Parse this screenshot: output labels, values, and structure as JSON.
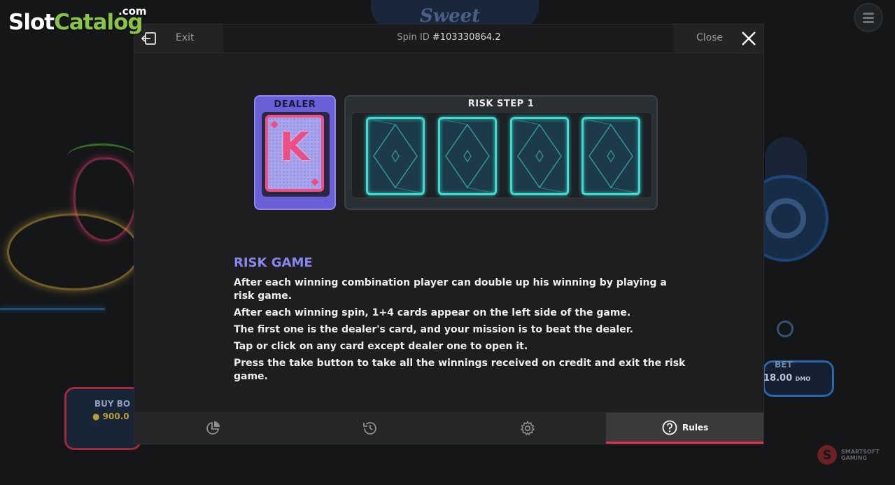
{
  "watermark": {
    "part1": "Slot",
    "part2": "Catalog",
    "part3": ".com"
  },
  "background": {
    "game_title": "Sweet",
    "buy_bonus_label": "BUY BO",
    "buy_bonus_value": "900.0",
    "bet_label": "BET",
    "bet_value": "18.00",
    "bet_currency": "DMO",
    "brand_line1": "SMARTSOFT",
    "brand_line2": "GAMING",
    "brand_logo": "S"
  },
  "topbar": {
    "exit_label": "Exit",
    "spin_id_label": "Spin ID",
    "spin_id_value": "#103330864.2",
    "close_label": "Close"
  },
  "dealer": {
    "title": "DEALER",
    "card_rank": "K",
    "card_color": "#ec4f85"
  },
  "risk": {
    "title": "RISK STEP 1",
    "card_count": 4,
    "card_color": "#43d8cf"
  },
  "rules": {
    "heading": "RISK GAME",
    "paragraphs": [
      "After each winning combination player can double up his winning by playing a risk game.",
      "After each winning spin, 1+4 cards appear on the left side of the game.",
      "The first one is the dealer's card, and your mission is to beat the dealer.",
      "Tap or click on any card except dealer one to open it.",
      "Press the take button to take all the winnings received on credit and exit the risk game."
    ]
  },
  "tabs": [
    {
      "icon": "pie-chart-icon",
      "label": "",
      "active": false
    },
    {
      "icon": "history-icon",
      "label": "",
      "active": false
    },
    {
      "icon": "gear-icon",
      "label": "",
      "active": false
    },
    {
      "icon": "help-icon",
      "label": "Rules",
      "active": true
    }
  ],
  "colors": {
    "accent": "#e8304f",
    "heading": "#8a86f0",
    "dealer_panel": "#6a5fd6"
  }
}
